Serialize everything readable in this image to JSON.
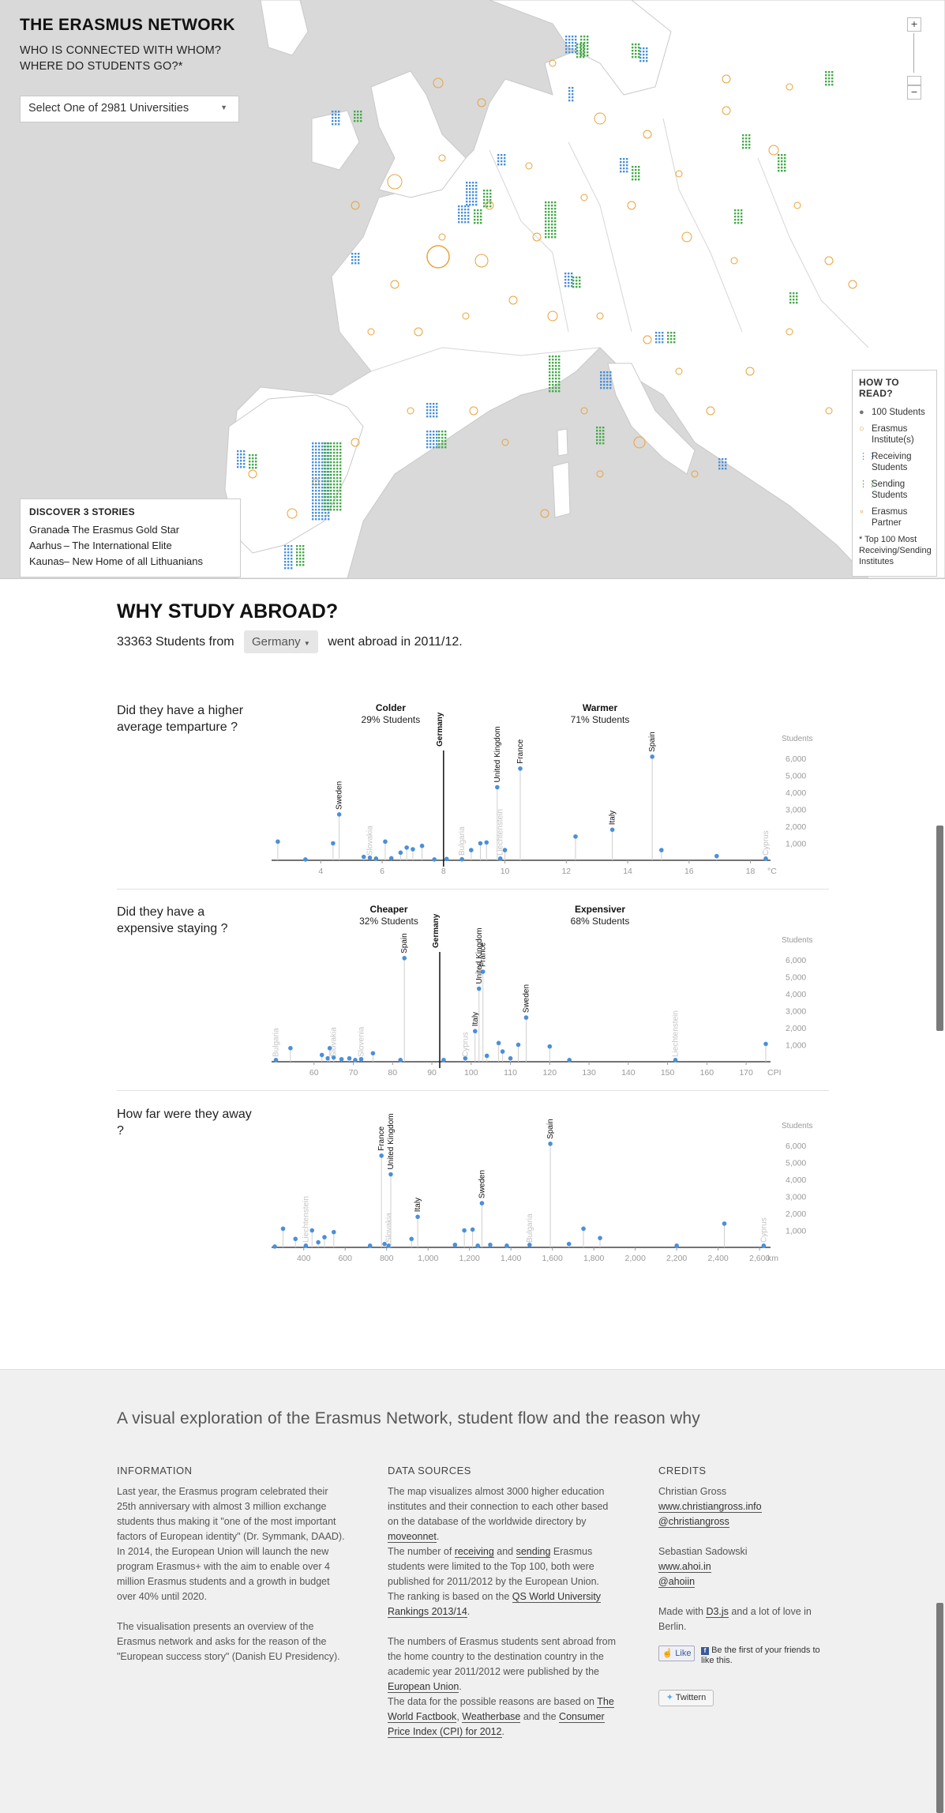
{
  "map": {
    "title": "THE ERASMUS NETWORK",
    "subtitle_line1": "WHO IS CONNECTED WITH WHOM?",
    "subtitle_line2": "WHERE DO STUDENTS GO?*",
    "select_value": "Select One of 2981 Universities",
    "zoom_in": "+",
    "zoom_out": "−",
    "legend": {
      "title": "HOW TO READ?",
      "items": [
        {
          "icon": "student-icon",
          "label": "100 Students"
        },
        {
          "icon": "institute-circle-icon",
          "label": "Erasmus Institute(s)"
        },
        {
          "icon": "receiving-icon",
          "label": "Receiving Students"
        },
        {
          "icon": "sending-icon",
          "label": "Sending Students"
        },
        {
          "icon": "partner-icon",
          "label": "Erasmus Partner"
        }
      ],
      "note": "* Top 100 Most Receiving/Sending Institutes"
    },
    "stories": {
      "title": "DISCOVER 3 STORIES",
      "items": [
        {
          "city": "Granada",
          "text": "– The Erasmus Gold Star"
        },
        {
          "city": "Aarhus",
          "text": "– The International Elite"
        },
        {
          "city": "Kaunas",
          "text": "– New Home of all Lithuanians"
        }
      ]
    },
    "colors": {
      "receiving": "#4a90d9",
      "sending": "#46a94a",
      "institute": "#e8a33a",
      "land": "#ffffff",
      "sea": "#d9d9d9"
    }
  },
  "why": {
    "title": "WHY STUDY ABROAD?",
    "count_text": "33363 Students from",
    "country": "Germany",
    "suffix": "went abroad in 2011/12."
  },
  "chart_data": [
    {
      "type": "scatter",
      "question_line1": "Did they have a higher",
      "question_line2": "average temparture ?",
      "left_label": "Colder",
      "left_pct": "29% Students",
      "right_label": "Warmer",
      "right_pct": "71% Students",
      "ylabel": "Students",
      "yticks": [
        "1,000",
        "2,000",
        "3,000",
        "4,000",
        "5,000",
        "6,000"
      ],
      "ylim": [
        0,
        6500
      ],
      "xlim": [
        2.5,
        18.5
      ],
      "xticks": [
        4,
        6,
        8,
        10,
        12,
        14,
        16,
        18
      ],
      "xtick_labels": [
        "4",
        "6",
        "8",
        "10",
        "12",
        "14",
        "16",
        "18"
      ],
      "x_unit": "°C",
      "reference": {
        "label": "Germany",
        "x": 8.0
      },
      "points": [
        {
          "x": 2.6,
          "y": 1100
        },
        {
          "x": 3.5,
          "y": 50
        },
        {
          "x": 4.4,
          "y": 1000
        },
        {
          "x": 4.6,
          "y": 2700,
          "label": "Sweden",
          "labeled": true
        },
        {
          "x": 5.4,
          "y": 200
        },
        {
          "x": 5.6,
          "y": 150,
          "label": "Slovakia",
          "faded": true
        },
        {
          "x": 5.8,
          "y": 100
        },
        {
          "x": 6.1,
          "y": 1100
        },
        {
          "x": 6.3,
          "y": 120
        },
        {
          "x": 6.6,
          "y": 450
        },
        {
          "x": 6.8,
          "y": 750
        },
        {
          "x": 7.0,
          "y": 650
        },
        {
          "x": 7.3,
          "y": 850
        },
        {
          "x": 7.7,
          "y": 50
        },
        {
          "x": 8.1,
          "y": 80
        },
        {
          "x": 8.6,
          "y": 60,
          "label": "Bulgaria",
          "faded": true
        },
        {
          "x": 8.9,
          "y": 600
        },
        {
          "x": 9.2,
          "y": 1000
        },
        {
          "x": 9.4,
          "y": 1050
        },
        {
          "x": 9.75,
          "y": 4300,
          "label": "United Kingdom",
          "labeled": true
        },
        {
          "x": 9.85,
          "y": 100,
          "label": "Liechtenstein",
          "faded": true
        },
        {
          "x": 10.0,
          "y": 600
        },
        {
          "x": 10.5,
          "y": 5400,
          "label": "France",
          "labeled": true
        },
        {
          "x": 12.3,
          "y": 1400
        },
        {
          "x": 13.5,
          "y": 1800,
          "label": "Italy",
          "labeled": true
        },
        {
          "x": 14.8,
          "y": 6100,
          "label": "Spain",
          "labeled": true
        },
        {
          "x": 15.1,
          "y": 600
        },
        {
          "x": 16.9,
          "y": 250
        },
        {
          "x": 18.5,
          "y": 100,
          "label": "Cyprus",
          "faded": true
        }
      ]
    },
    {
      "type": "scatter",
      "question_line1": "Did they have a",
      "question_line2": "expensive staying ?",
      "left_label": "Cheaper",
      "left_pct": "32% Students",
      "right_label": "Expensiver",
      "right_pct": "68% Students",
      "ylabel": "Students",
      "yticks": [
        "1,000",
        "2,000",
        "3,000",
        "4,000",
        "5,000",
        "6,000"
      ],
      "ylim": [
        0,
        6500
      ],
      "xlim": [
        50,
        175
      ],
      "xticks": [
        60,
        70,
        80,
        90,
        100,
        110,
        120,
        130,
        140,
        150,
        160,
        170
      ],
      "xtick_labels": [
        "60",
        "70",
        "80",
        "90",
        "100",
        "110",
        "120",
        "130",
        "140",
        "150",
        "160",
        "170"
      ],
      "x_unit": "CPI",
      "reference": {
        "label": "Germany",
        "x": 92
      },
      "points": [
        {
          "x": 50.3,
          "y": 100,
          "label": "Bulgaria",
          "faded": true
        },
        {
          "x": 54,
          "y": 800
        },
        {
          "x": 62,
          "y": 400
        },
        {
          "x": 63.5,
          "y": 200
        },
        {
          "x": 64,
          "y": 800
        },
        {
          "x": 65,
          "y": 250,
          "label": "Slovakia",
          "faded": true
        },
        {
          "x": 67,
          "y": 150
        },
        {
          "x": 69,
          "y": 200
        },
        {
          "x": 70.5,
          "y": 100
        },
        {
          "x": 72,
          "y": 150,
          "label": "Slovenia",
          "faded": true
        },
        {
          "x": 75,
          "y": 500
        },
        {
          "x": 82,
          "y": 100
        },
        {
          "x": 83,
          "y": 6100,
          "label": "Spain",
          "labeled": true
        },
        {
          "x": 93,
          "y": 100
        },
        {
          "x": 98.5,
          "y": 200,
          "label": "Cyprus",
          "faded": true
        },
        {
          "x": 101,
          "y": 1800,
          "label": "Italy",
          "labeled": true
        },
        {
          "x": 102,
          "y": 4300,
          "label": "United Kingdom",
          "labeled": true
        },
        {
          "x": 103,
          "y": 5300,
          "label": "France",
          "labeled": true
        },
        {
          "x": 104,
          "y": 350
        },
        {
          "x": 107,
          "y": 1100
        },
        {
          "x": 108,
          "y": 600
        },
        {
          "x": 110,
          "y": 200
        },
        {
          "x": 112,
          "y": 1000
        },
        {
          "x": 114,
          "y": 2600,
          "label": "Sweden",
          "labeled": true
        },
        {
          "x": 120,
          "y": 900
        },
        {
          "x": 125,
          "y": 100
        },
        {
          "x": 152,
          "y": 100,
          "label": "Liechtenstein",
          "faded": true
        },
        {
          "x": 175,
          "y": 1050
        }
      ]
    },
    {
      "type": "scatter",
      "question_line1": "How far were they away",
      "question_line2": "?",
      "left_label": "",
      "left_pct": "",
      "right_label": "",
      "right_pct": "",
      "ylabel": "Students",
      "yticks": [
        "1,000",
        "2,000",
        "3,000",
        "4,000",
        "5,000",
        "6,000"
      ],
      "ylim": [
        0,
        6500
      ],
      "xlim": [
        260,
        2630
      ],
      "xticks": [
        400,
        600,
        800,
        1000,
        1200,
        1400,
        1600,
        1800,
        2000,
        2200,
        2400,
        2600
      ],
      "xtick_labels": [
        "400",
        "600",
        "800",
        "1,000",
        "1,200",
        "1,400",
        "1,600",
        "1,800",
        "2,000",
        "2,200",
        "2,400",
        "2,600"
      ],
      "x_unit": "km",
      "reference": null,
      "points": [
        {
          "x": 260,
          "y": 50
        },
        {
          "x": 300,
          "y": 1100
        },
        {
          "x": 360,
          "y": 500
        },
        {
          "x": 410,
          "y": 100,
          "label": "Liechtenstein",
          "faded": true
        },
        {
          "x": 440,
          "y": 1000
        },
        {
          "x": 470,
          "y": 300
        },
        {
          "x": 500,
          "y": 600
        },
        {
          "x": 545,
          "y": 900
        },
        {
          "x": 720,
          "y": 100
        },
        {
          "x": 775,
          "y": 5400,
          "label": "France",
          "labeled": true
        },
        {
          "x": 790,
          "y": 200
        },
        {
          "x": 810,
          "y": 100,
          "label": "Slovakia",
          "faded": true
        },
        {
          "x": 820,
          "y": 4300,
          "label": "United Kingdom",
          "labeled": true
        },
        {
          "x": 920,
          "y": 500
        },
        {
          "x": 950,
          "y": 1800,
          "label": "Italy",
          "labeled": true
        },
        {
          "x": 1130,
          "y": 150
        },
        {
          "x": 1175,
          "y": 1000
        },
        {
          "x": 1215,
          "y": 1050
        },
        {
          "x": 1240,
          "y": 100
        },
        {
          "x": 1260,
          "y": 2600,
          "label": "Sweden",
          "labeled": true
        },
        {
          "x": 1300,
          "y": 150
        },
        {
          "x": 1380,
          "y": 100
        },
        {
          "x": 1490,
          "y": 150,
          "label": "Bulgaria",
          "faded": true
        },
        {
          "x": 1590,
          "y": 6100,
          "label": "Spain",
          "labeled": true
        },
        {
          "x": 1680,
          "y": 200
        },
        {
          "x": 1750,
          "y": 1100
        },
        {
          "x": 1830,
          "y": 550
        },
        {
          "x": 2200,
          "y": 100
        },
        {
          "x": 2430,
          "y": 1400
        },
        {
          "x": 2620,
          "y": 100,
          "label": "Cyprus",
          "faded": true
        }
      ]
    }
  ],
  "footer": {
    "headline": "A visual exploration of the Erasmus Network, student flow and the reason why",
    "info": {
      "title": "INFORMATION",
      "p1": "Last year, the Erasmus program celebrated their 25th anniversary with almost 3 million exchange students thus making it \"one of the most important factors of European identity\" (Dr. Symmank, DAAD).",
      "p2": "In 2014, the European Union will launch the new program Erasmus+ with the aim to enable over 4 million Erasmus students and a growth in budget over 40% until 2020.",
      "p3": "The visualisation presents an overview of the Erasmus network and asks for the reason of the \"European success story\" (Danish EU Presidency)."
    },
    "sources": {
      "title": "DATA SOURCES",
      "s1_a": "The map visualizes almost 3000 higher education institutes and their connection to each other based on the database of the worldwide directory by ",
      "s1_link": "moveonnet",
      "s1_b": ".",
      "s2_a": "The number of ",
      "s2_link1": "receiving",
      "s2_and": " and ",
      "s2_link2": "sending",
      "s2_b": " Erasmus students were limited to the Top 100, both were published for 2011/2012 by the European Union.",
      "s3_a": "The ranking is based on the ",
      "s3_link": "QS World University Rankings 2013/14",
      "s3_b": ".",
      "s4_a": "The numbers of Erasmus students sent abroad from the home country to the destination country in the academic year 2011/2012 were published by the ",
      "s4_link": "European Union",
      "s4_b": ".",
      "s5_a": "The data for the possible reasons are based on ",
      "s5_link1": "The World Factbook",
      "s5_comma": ", ",
      "s5_link2": "Weatherbase",
      "s5_and": " and the ",
      "s5_link3": "Consumer Price Index (CPI) for 2012",
      "s5_b": "."
    },
    "credits": {
      "title": "CREDITS",
      "name1": "Christian Gross",
      "link1a": "www.christiangross.info",
      "link1b": "@christiangross",
      "name2": "Sebastian Sadowski",
      "link2a": "www.ahoi.in",
      "link2b": "@ahoiin",
      "made_a": "Made with ",
      "made_link": "D3.js",
      "made_b": " and a lot of love in Berlin.",
      "like_label": "Like",
      "like_text": "Be the first of your friends to like this.",
      "tweet_label": "Twittern"
    }
  }
}
